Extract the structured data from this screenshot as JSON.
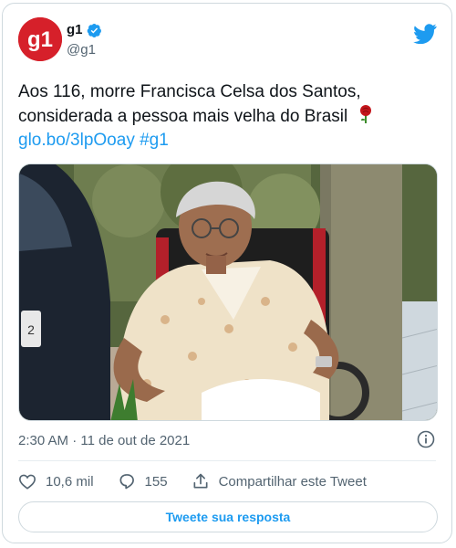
{
  "author": {
    "display_name": "g1",
    "handle": "@g1",
    "avatar_text": "g1",
    "verified": true
  },
  "tweet": {
    "text_line1": "Aos 116, morre Francisca Celsa dos Santos,",
    "text_line2": "considerada a pessoa mais velha do Brasil",
    "emoji": "rose",
    "link": "glo.bo/3lpOoay",
    "hashtag": "#g1",
    "timestamp": "2:30 AM · 11 de out de 2021"
  },
  "actions": {
    "likes": "10,6 mil",
    "replies": "155",
    "share_label": "Compartilhar este Tweet"
  },
  "reply_button": {
    "label": "Tweete sua resposta"
  },
  "colors": {
    "brand": "#d6202a",
    "link": "#1d9bf0",
    "muted": "#536471"
  },
  "icons": {
    "logo": "twitter-bird-icon",
    "verified": "verified-badge-icon",
    "info": "info-icon",
    "like": "heart-icon",
    "reply": "reply-bubble-icon",
    "share": "share-icon"
  }
}
